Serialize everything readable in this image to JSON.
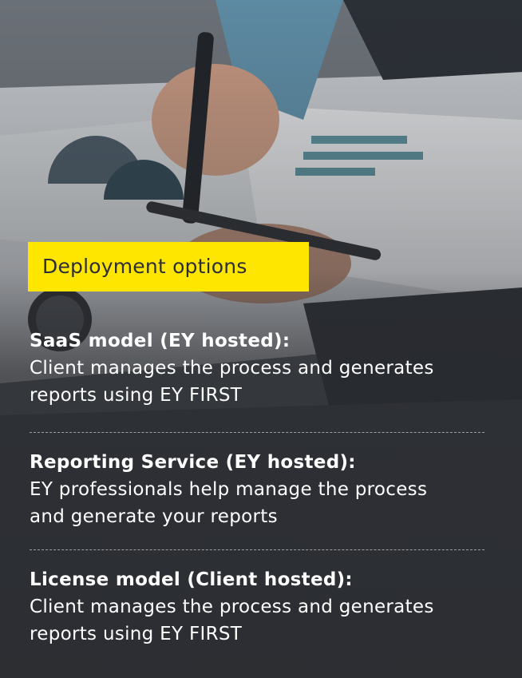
{
  "header": {
    "badge_label": "Deployment options"
  },
  "options": [
    {
      "title": "SaaS model (EY hosted):",
      "description_line1": "Client manages the process and generates",
      "description_line2": "reports using EY FIRST"
    },
    {
      "title": "Reporting Service (EY hosted):",
      "description_line1": "EY professionals help manage the process",
      "description_line2": "and generate your reports"
    },
    {
      "title": "License model (Client hosted):",
      "description_line1": "Client manages the process and generates",
      "description_line2": "reports using EY FIRST"
    }
  ],
  "colors": {
    "accent_yellow": "#ffe600",
    "badge_text": "#2e2e38",
    "text": "#ffffff",
    "background_dark": "#2e3035"
  }
}
